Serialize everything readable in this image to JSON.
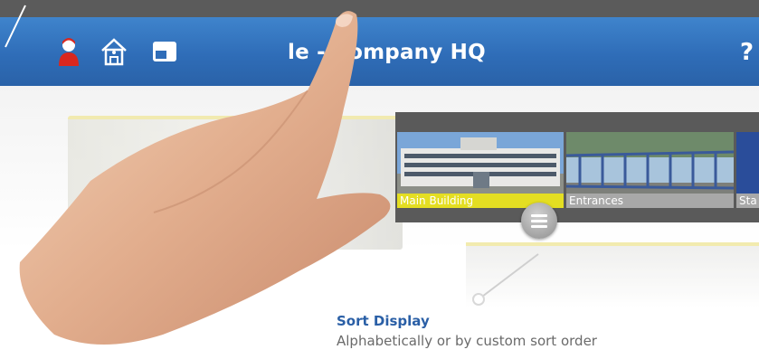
{
  "header": {
    "title": "le - Company HQ",
    "help_label": "?",
    "icons": [
      "user-icon",
      "home-icon",
      "window-icon"
    ]
  },
  "cameras": [
    {
      "label": "Main Building",
      "selected": true
    },
    {
      "label": "Entrances",
      "selected": false
    },
    {
      "label": "Sta",
      "selected": false
    }
  ],
  "feature": {
    "title": "Sort Display",
    "description": "Alphabetically or by custom sort order"
  },
  "colors": {
    "header_blue": "#2f6db8",
    "selected_label": "#e4de22",
    "title_blue": "#2a5fa6"
  }
}
